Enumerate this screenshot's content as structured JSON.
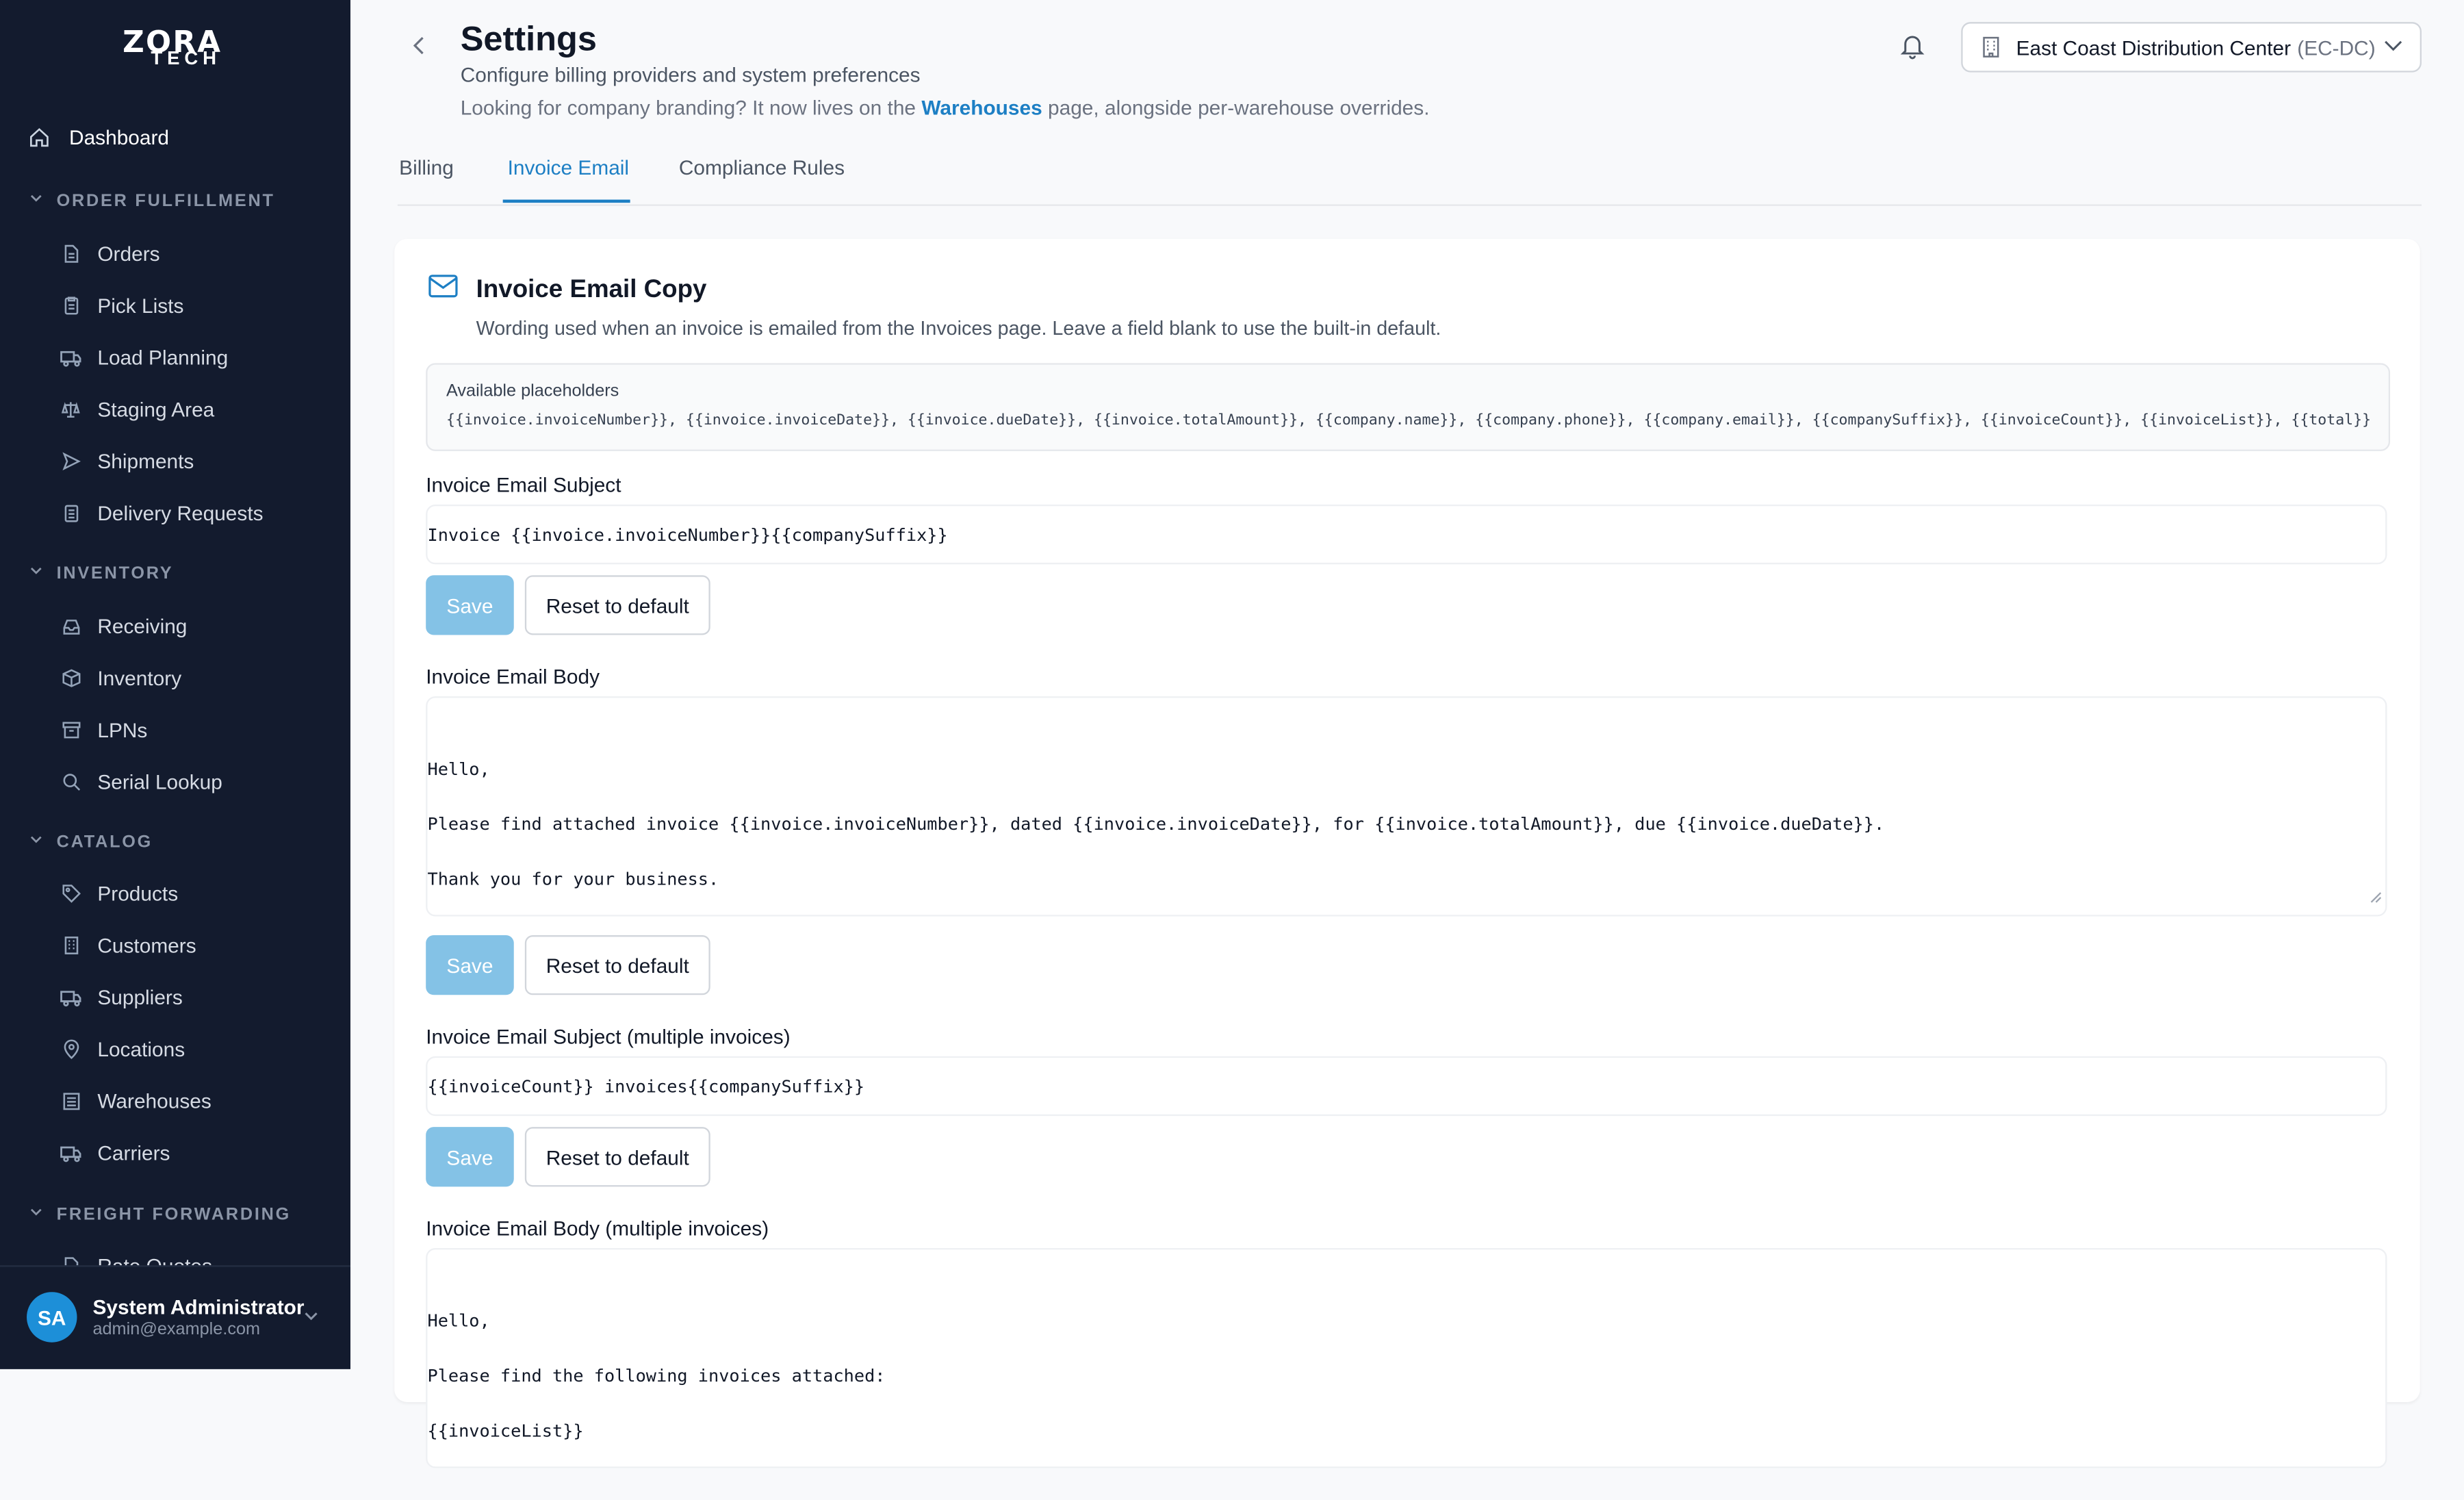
{
  "brand": {
    "line1": "ZORA",
    "line2": "TECH"
  },
  "sidebar": {
    "dashboard": "Dashboard",
    "sections": [
      {
        "title": "ORDER FULFILLMENT",
        "items": [
          "Orders",
          "Pick Lists",
          "Load Planning",
          "Staging Area",
          "Shipments",
          "Delivery Requests"
        ]
      },
      {
        "title": "INVENTORY",
        "items": [
          "Receiving",
          "Inventory",
          "LPNs",
          "Serial Lookup"
        ]
      },
      {
        "title": "CATALOG",
        "items": [
          "Products",
          "Customers",
          "Suppliers",
          "Locations",
          "Warehouses",
          "Carriers"
        ]
      },
      {
        "title": "FREIGHT FORWARDING",
        "items": [
          "Rate Quotes"
        ]
      }
    ]
  },
  "user": {
    "initials": "SA",
    "name": "System Administrator",
    "email": "admin@example.com"
  },
  "header": {
    "title": "Settings",
    "subtitle": "Configure billing providers and system preferences",
    "note_before": "Looking for company branding? It now lives on the ",
    "note_link": "Warehouses",
    "note_after": " page, alongside per-warehouse overrides."
  },
  "warehouse_select": {
    "name": "East Coast Distribution Center",
    "code": "(EC-DC)"
  },
  "tabs": [
    "Billing",
    "Invoice Email",
    "Compliance Rules"
  ],
  "active_tab": "Invoice Email",
  "card": {
    "title": "Invoice Email Copy",
    "description": "Wording used when an invoice is emailed from the Invoices page. Leave a field blank to use the built-in default.",
    "placeholders_label": "Available placeholders",
    "placeholders": "{{invoice.invoiceNumber}}, {{invoice.invoiceDate}}, {{invoice.dueDate}}, {{invoice.totalAmount}}, {{company.name}}, {{company.phone}}, {{company.email}}, {{companySuffix}}, {{invoiceCount}}, {{invoiceList}}, {{total}}"
  },
  "fields": {
    "subject": {
      "label": "Invoice Email Subject",
      "value": "Invoice {{invoice.invoiceNumber}}{{companySuffix}}"
    },
    "body": {
      "label": "Invoice Email Body",
      "value": "Hello,\n\nPlease find attached invoice {{invoice.invoiceNumber}}, dated {{invoice.invoiceDate}}, for {{invoice.totalAmount}}, due {{invoice.dueDate}}.\n\nThank you for your business."
    },
    "multi_subject": {
      "label": "Invoice Email Subject (multiple invoices)",
      "value": "{{invoiceCount}} invoices{{companySuffix}}"
    },
    "multi_body": {
      "label": "Invoice Email Body (multiple invoices)",
      "value": "Hello,\n\nPlease find the following invoices attached:\n\n{{invoiceList}}"
    }
  },
  "buttons": {
    "save": "Save",
    "reset": "Reset to default"
  },
  "colors": {
    "sidebar_bg": "#131b2e",
    "accent": "#1d7fc4",
    "save_disabled": "#84c2e6",
    "avatar": "#1d8fd8"
  }
}
